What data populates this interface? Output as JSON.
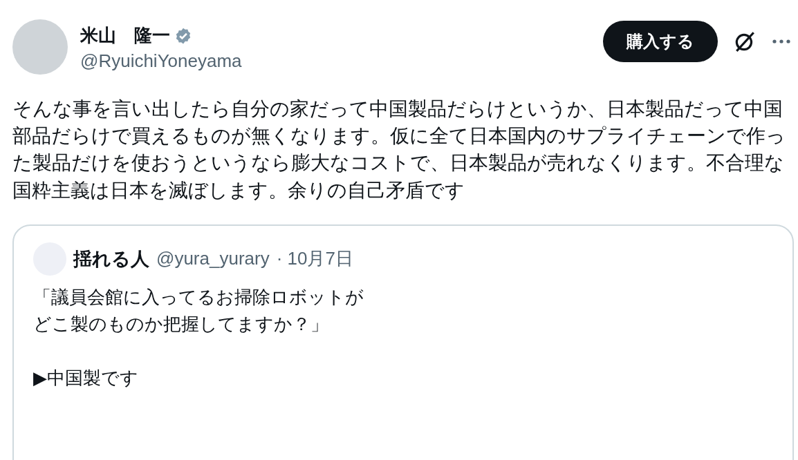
{
  "author": {
    "name": "米山　隆一",
    "handle": "@RyuichiYoneyama",
    "verified": true
  },
  "buy_button": "購入する",
  "text": "そんな事を言い出したら自分の家だって中国製品だらけというか、日本製品だって中国部品だらけで買えるものが無くなります。仮に全て日本国内のサプライチェーンで作った製品だけを使おうというなら膨大なコストで、日本製品が売れなくります。不合理な国粋主義は日本を滅ぼします。余りの自己矛盾です",
  "quoted": {
    "name": "揺れる人",
    "handle": "@yura_yurary",
    "date": "· 10月7日",
    "paragraphs": [
      {
        "lines": [
          "「議員会館に入ってるお掃除ロボットが",
          "どこ製のものか把握してますか？」"
        ]
      },
      {
        "lines": [
          "▶中国製です"
        ]
      }
    ]
  }
}
